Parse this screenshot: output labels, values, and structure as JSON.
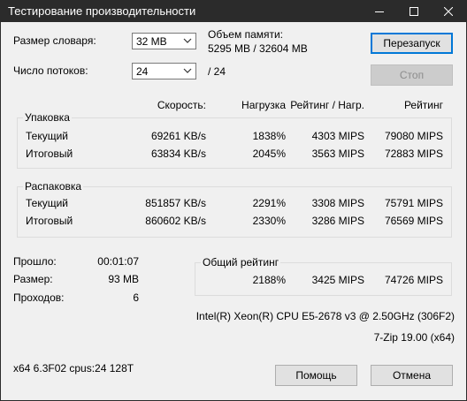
{
  "window": {
    "title": "Тестирование производительности"
  },
  "dict_size": {
    "label": "Размер словаря:",
    "value": "32 MB"
  },
  "threads": {
    "label": "Число потоков:",
    "value": "24",
    "max": "/ 24"
  },
  "memory": {
    "label": "Объем памяти:",
    "value": "5295 MB / 32604 MB"
  },
  "buttons": {
    "restart": "Перезапуск",
    "stop": "Стоп",
    "help": "Помощь",
    "cancel": "Отмена"
  },
  "columns": {
    "speed": "Скорость:",
    "usage": "Нагрузка",
    "rating_usage": "Рейтинг / Нагр.",
    "rating": "Рейтинг"
  },
  "compress": {
    "title": "Упаковка",
    "rows": [
      {
        "name": "Текущий",
        "speed": "69261 KB/s",
        "usage": "1838%",
        "rpu": "4303 MIPS",
        "rating": "79080 MIPS"
      },
      {
        "name": "Итоговый",
        "speed": "63834 KB/s",
        "usage": "2045%",
        "rpu": "3563 MIPS",
        "rating": "72883 MIPS"
      }
    ]
  },
  "decompress": {
    "title": "Распаковка",
    "rows": [
      {
        "name": "Текущий",
        "speed": "851857 KB/s",
        "usage": "2291%",
        "rpu": "3308 MIPS",
        "rating": "75791 MIPS"
      },
      {
        "name": "Итоговый",
        "speed": "860602 KB/s",
        "usage": "2330%",
        "rpu": "3286 MIPS",
        "rating": "76569 MIPS"
      }
    ]
  },
  "stats": {
    "elapsed_label": "Прошло:",
    "elapsed": "00:01:07",
    "size_label": "Размер:",
    "size": "93 MB",
    "passes_label": "Проходов:",
    "passes": "6"
  },
  "total": {
    "title": "Общий рейтинг",
    "usage": "2188%",
    "rpu": "3425 MIPS",
    "rating": "74726 MIPS"
  },
  "cpu_info": "Intel(R) Xeon(R) CPU E5-2678 v3 @ 2.50GHz (306F2)",
  "version": "7-Zip 19.00 (x64)",
  "sys_info": "x64 6.3F02 cpus:24 128T"
}
